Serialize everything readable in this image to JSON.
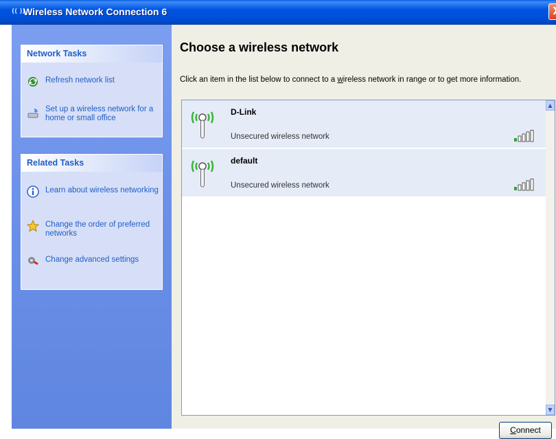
{
  "window": {
    "title": "Wireless Network Connection 6",
    "title_icon": "(( ))",
    "close_glyph": "X"
  },
  "sidebar": {
    "network_tasks": {
      "heading": "Network Tasks",
      "items": [
        {
          "label": "Refresh network list",
          "icon": "refresh-icon"
        },
        {
          "label": "Set up a wireless network for a home or small office",
          "icon": "setup-wizard-icon"
        }
      ]
    },
    "related_tasks": {
      "heading": "Related Tasks",
      "items": [
        {
          "label": "Learn about wireless networking",
          "icon": "info-icon"
        },
        {
          "label": "Change the order of preferred networks",
          "icon": "star-icon"
        },
        {
          "label": "Change advanced settings",
          "icon": "settings-icon"
        }
      ]
    }
  },
  "main": {
    "title": "Choose a wireless network",
    "instructions_before": "Click an item in the list below to connect to a ",
    "instructions_underlined": "w",
    "instructions_after": "ireless network in range or to get more information."
  },
  "networks": [
    {
      "name": "D-Link",
      "status": "Unsecured wireless network",
      "signal_bars": 5
    },
    {
      "name": "default",
      "status": "Unsecured wireless network",
      "signal_bars": 5
    }
  ],
  "buttons": {
    "connect_underlined": "C",
    "connect_rest": "onnect"
  },
  "colors": {
    "title_bar": "#0054e3",
    "sidebar": "#6a8fe8",
    "link": "#215dc6",
    "selected_row": "#e6ebf8",
    "antenna_green": "#3cb43c"
  }
}
